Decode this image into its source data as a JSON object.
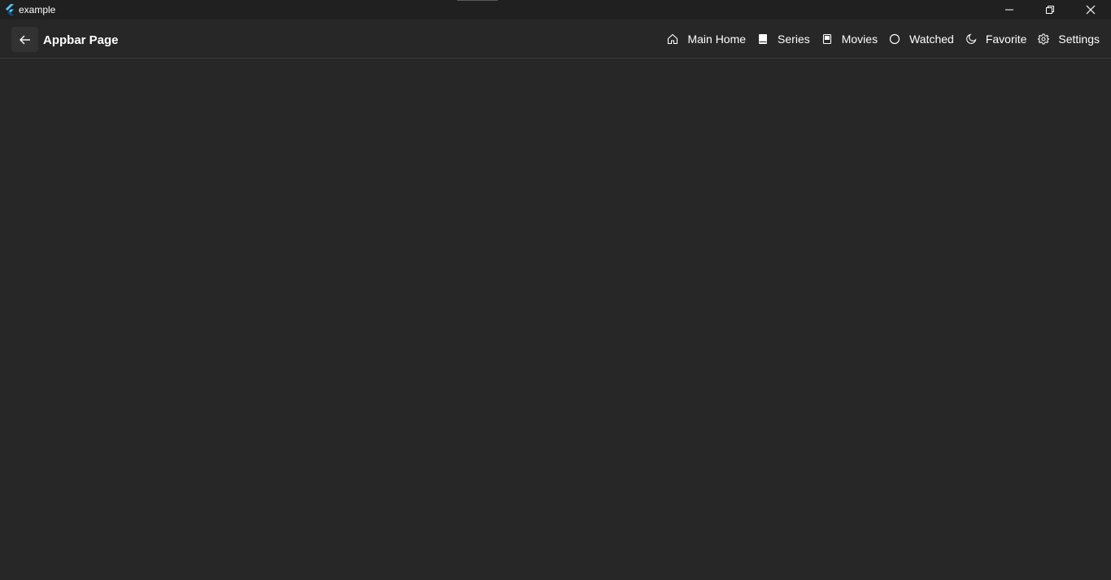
{
  "window": {
    "title": "example",
    "controls": [
      "minimize",
      "restore",
      "close"
    ]
  },
  "appbar": {
    "back_icon": "arrow-left-icon",
    "title": "Appbar Page",
    "nav": [
      {
        "label": "Main Home",
        "icon": "home-icon"
      },
      {
        "label": "Series",
        "icon": "book-filled-icon"
      },
      {
        "label": "Movies",
        "icon": "book-outline-icon"
      },
      {
        "label": "Watched",
        "icon": "circle-icon"
      },
      {
        "label": "Favorite",
        "icon": "moon-icon"
      },
      {
        "label": "Settings",
        "icon": "gear-icon"
      }
    ]
  },
  "colors": {
    "background": "#272727",
    "titlebar": "#202020",
    "text": "#ffffff",
    "flutter_blue": "#42a5f5"
  }
}
